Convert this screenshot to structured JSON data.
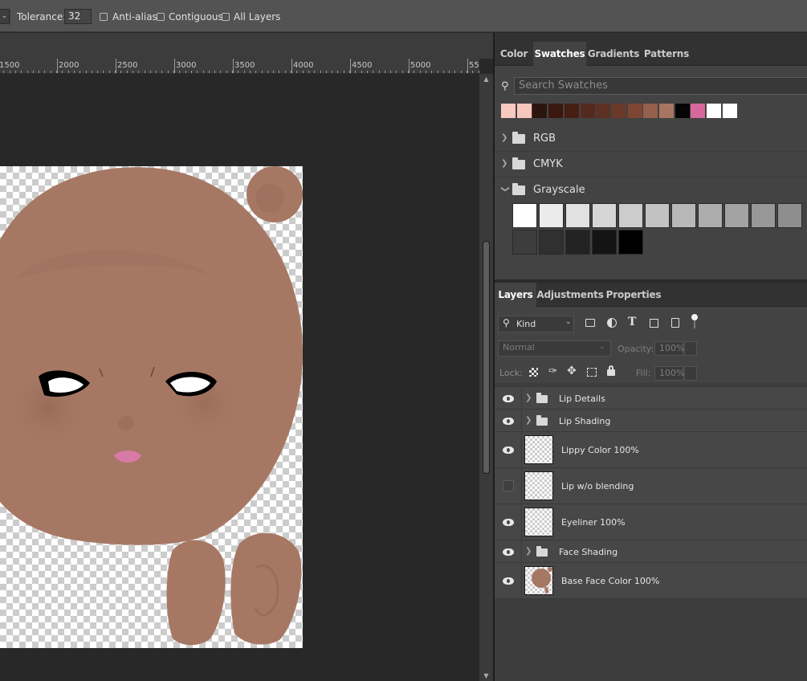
{
  "options_bar": {
    "tolerance_label": "Tolerance:",
    "tolerance_value": "32",
    "anti_alias_label": "Anti-alias",
    "contiguous_label": "Contiguous",
    "all_layers_label": "All Layers"
  },
  "ruler": {
    "labels": [
      "1500",
      "2000",
      "2500",
      "3000",
      "3500",
      "4000",
      "4500",
      "5000",
      "55"
    ]
  },
  "swatches_panel": {
    "tabs": [
      "Color",
      "Swatches",
      "Gradients",
      "Patterns"
    ],
    "active_tab": "Swatches",
    "search_placeholder": "Search Swatches",
    "recent_colors": [
      "#f9c8c0",
      "#f7c7bd",
      "#2c140f",
      "#3a1810",
      "#461e13",
      "#542a1e",
      "#5d3023",
      "#6a392a",
      "#7e4633",
      "#95604c",
      "#a77562",
      "#050505",
      "#d6689b",
      "#ffffff",
      "#ffffff"
    ],
    "folders": [
      {
        "name": "RGB",
        "expanded": false
      },
      {
        "name": "CMYK",
        "expanded": false
      },
      {
        "name": "Grayscale",
        "expanded": true
      }
    ],
    "grayscale_row1": [
      "#ffffff",
      "#ebebeb",
      "#e1e1e1",
      "#d6d6d6",
      "#cccccc",
      "#c2c2c2",
      "#b8b8b8",
      "#adadad",
      "#a3a3a3",
      "#989898",
      "#8e8e8e"
    ],
    "grayscale_row2": [
      "#3d3d3d",
      "#303030",
      "#232323",
      "#141414",
      "#000000"
    ]
  },
  "layers_panel": {
    "tabs": [
      "Layers",
      "Adjustments",
      "Properties"
    ],
    "active_tab": "Layers",
    "filter_label": "Kind",
    "blend_mode": "Normal",
    "opacity_label": "Opacity:",
    "opacity_value": "100%",
    "lock_label": "Lock:",
    "fill_label": "Fill:",
    "fill_value": "100%",
    "layers": [
      {
        "name": "Lip Details",
        "type": "group",
        "visible": true
      },
      {
        "name": "Lip Shading",
        "type": "group",
        "visible": true
      },
      {
        "name": "Lippy Color 100%",
        "type": "layer",
        "visible": true
      },
      {
        "name": "Lip w/o blending",
        "type": "layer",
        "visible": false
      },
      {
        "name": "Eyeliner 100%",
        "type": "layer",
        "visible": true
      },
      {
        "name": "Face Shading",
        "type": "group",
        "visible": true
      },
      {
        "name": "Base Face Color 100%",
        "type": "layer",
        "visible": true
      }
    ]
  },
  "colors": {
    "skin": "#a67864",
    "lip": "#d77aa6",
    "panel_bg": "#434343",
    "workspace_bg": "#282828"
  }
}
